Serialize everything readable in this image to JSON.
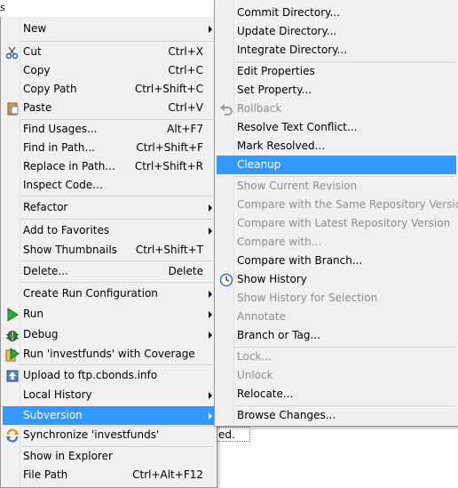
{
  "background": {
    "top_text": "s",
    "bottom_text": "ed."
  },
  "left_menu": {
    "new": "New",
    "cut": "Cut",
    "cut_sc": "Ctrl+X",
    "copy": "Copy",
    "copy_sc": "Ctrl+C",
    "copy_path": "Copy Path",
    "copy_path_sc": "Ctrl+Shift+C",
    "paste": "Paste",
    "paste_sc": "Ctrl+V",
    "find_usages": "Find Usages...",
    "find_usages_sc": "Alt+F7",
    "find_in_path": "Find in Path...",
    "find_in_path_sc": "Ctrl+Shift+F",
    "replace_in_path": "Replace in Path...",
    "replace_in_path_sc": "Ctrl+Shift+R",
    "inspect_code": "Inspect Code...",
    "refactor": "Refactor",
    "add_to_favorites": "Add to Favorites",
    "show_thumbnails": "Show Thumbnails",
    "show_thumbnails_sc": "Ctrl+Shift+T",
    "delete": "Delete...",
    "delete_sc": "Delete",
    "create_run_config": "Create Run Configuration",
    "run": "Run",
    "debug": "Debug",
    "run_coverage": "Run 'investfunds' with Coverage",
    "upload": "Upload to ftp.cbonds.info",
    "local_history": "Local History",
    "subversion": "Subversion",
    "synchronize": "Synchronize 'investfunds'",
    "show_in_explorer": "Show in Explorer",
    "file_path": "File Path",
    "file_path_sc": "Ctrl+Alt+F12"
  },
  "right_menu": {
    "commit_directory": "Commit Directory...",
    "update_directory": "Update Directory...",
    "integrate_directory": "Integrate Directory...",
    "edit_properties": "Edit Properties",
    "set_property": "Set Property...",
    "rollback": "Rollback",
    "resolve_text_conflict": "Resolve Text Conflict...",
    "mark_resolved": "Mark Resolved...",
    "cleanup": "Cleanup",
    "show_current_revision": "Show Current Revision",
    "compare_same_repo": "Compare with the Same Repository Version",
    "compare_latest_repo": "Compare with Latest Repository Version",
    "compare_with": "Compare with...",
    "compare_with_branch": "Compare with Branch...",
    "show_history": "Show History",
    "show_history_selection": "Show History for Selection",
    "annotate": "Annotate",
    "branch_or_tag": "Branch or Tag...",
    "lock": "Lock...",
    "unlock": "Unlock",
    "relocate": "Relocate...",
    "browse_changes": "Browse Changes..."
  },
  "colors": {
    "highlight": "#3399ff",
    "menu_bg": "#f0f0f0",
    "disabled": "#8e8e8e"
  }
}
